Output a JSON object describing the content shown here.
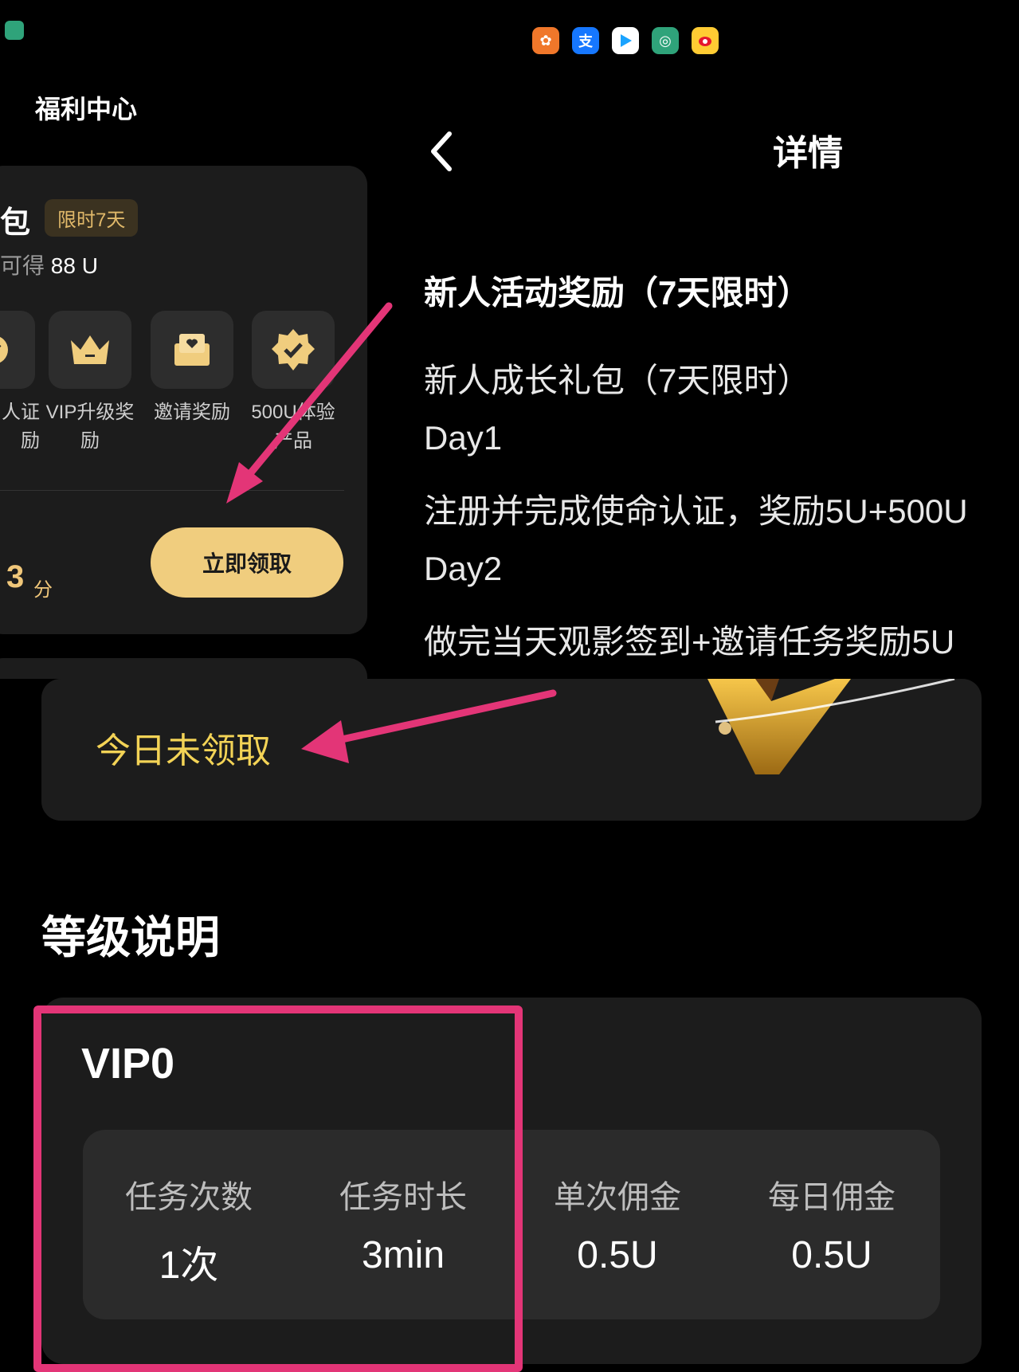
{
  "status_bar": {
    "apps": [
      "baidu-netdisk-icon",
      "alipay-icon",
      "video-app-icon",
      "bank-app-icon",
      "weibo-icon"
    ],
    "alipay_glyph": "支"
  },
  "welfare": {
    "title": "福利中心",
    "card": {
      "title": "包",
      "badge": "限时7天",
      "subtitle_prefix": "可得",
      "subtitle_value": "88 U",
      "features": [
        {
          "icon": "check-icon",
          "label": "人证\n励"
        },
        {
          "icon": "crown-icon",
          "label": "VIP升级奖\n励"
        },
        {
          "icon": "envelope-heart-icon",
          "label": "邀请奖励"
        },
        {
          "icon": "verified-badge-icon",
          "label": "500U体验\n产品"
        }
      ],
      "score": "3",
      "score_unit": "分",
      "claim_button": "立即领取"
    }
  },
  "details": {
    "title": "详情",
    "heading": "新人活动奖励（7天限时）",
    "lines": [
      "新人成长礼包（7天限时）",
      "Day1",
      "注册并完成使命认证，奖励5U+500U",
      "Day2",
      "做完当天观影签到+邀请任务奖励5U"
    ]
  },
  "checkin": {
    "status": "今日未领取"
  },
  "levels": {
    "title": "等级说明",
    "vip_name": "VIP0",
    "stats": [
      {
        "label": "任务次数",
        "value": "1次"
      },
      {
        "label": "任务时长",
        "value": "3min"
      },
      {
        "label": "单次佣金",
        "value": "0.5U"
      },
      {
        "label": "每日佣金",
        "value": "0.5U"
      }
    ]
  },
  "colors": {
    "accent_gold": "#f0cd7e",
    "annotation_pink": "#e33577",
    "status_yellow": "#f3d356"
  }
}
